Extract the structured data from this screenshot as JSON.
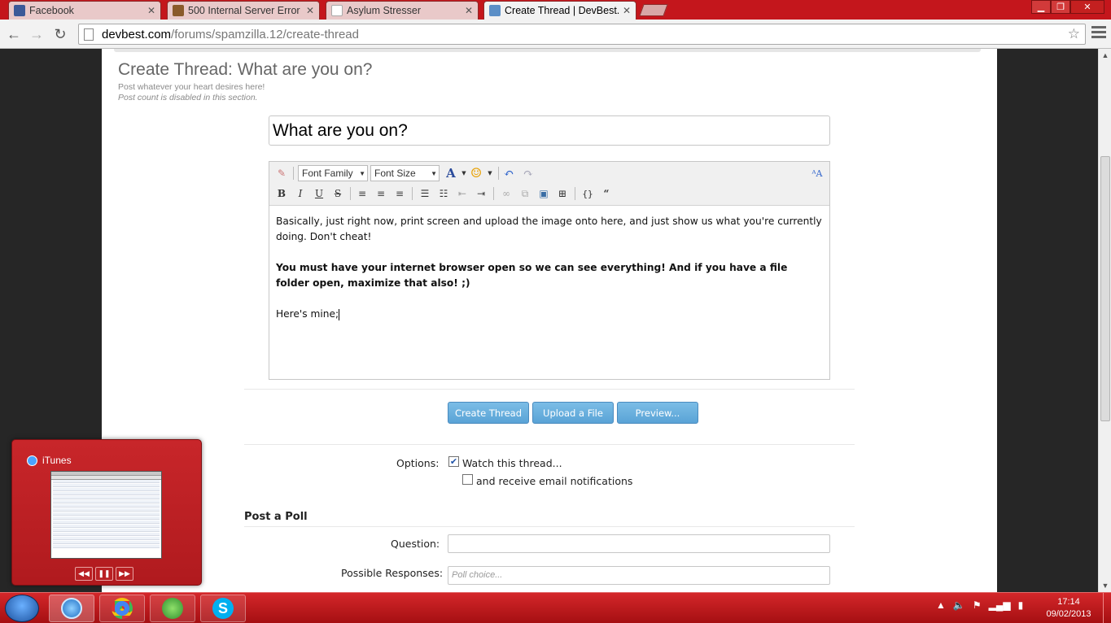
{
  "browser": {
    "tabs": [
      {
        "label": "Facebook",
        "icon": "facebook-icon",
        "color": "#3b5998"
      },
      {
        "label": "500 Internal Server Error",
        "icon": "error-page-icon",
        "color": "#8a5a2a"
      },
      {
        "label": "Asylum Stresser",
        "icon": "page-icon",
        "color": "#bbbbbb"
      },
      {
        "label": "Create Thread | DevBest.co",
        "icon": "devbest-icon",
        "color": "#5b8fc7"
      }
    ],
    "url_host": "devbest.com",
    "url_path": "/forums/spamzilla.12/create-thread"
  },
  "page": {
    "title": "Create Thread: What are you on?",
    "description": "Post whatever your heart desires here!",
    "note": "Post count is disabled in this section.",
    "thread_title_value": "What are you on?",
    "editor": {
      "font_family_label": "Font Family",
      "font_size_label": "Font Size",
      "paragraph_1": "Basically, just right now, print screen and upload the image onto here, and just show us what you're currently doing. Don't cheat!",
      "paragraph_2": "You must have your internet browser open so we can see everything! And if you have a file folder open, maximize that also! ;)",
      "paragraph_3": "Here's mine;"
    },
    "buttons": {
      "create": "Create Thread",
      "upload": "Upload a File",
      "preview": "Preview..."
    },
    "options": {
      "label": "Options:",
      "watch_label": "Watch this thread...",
      "watch_checked": true,
      "email_label": "and receive email notifications",
      "email_checked": false
    },
    "poll": {
      "title": "Post a Poll",
      "question_label": "Question:",
      "responses_label": "Possible Responses:",
      "choice_placeholder": "Poll choice..."
    }
  },
  "itunes_preview": {
    "title": "iTunes"
  },
  "taskbar": {
    "time": "17:14",
    "date": "09/02/2013"
  },
  "colors": {
    "chrome_frame": "#c4161c",
    "taskbar": "#b51a1e",
    "button_blue": "#5aa3d6"
  }
}
